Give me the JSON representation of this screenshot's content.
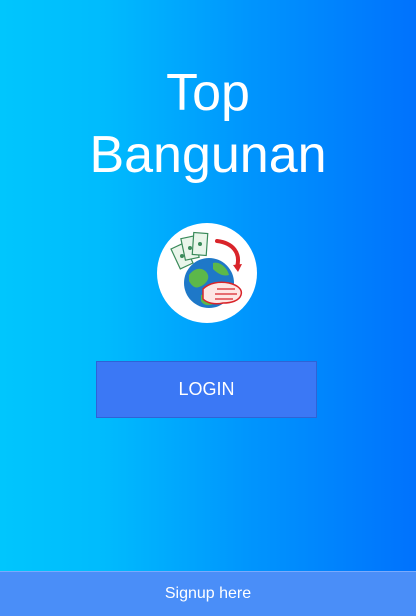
{
  "app": {
    "title_line1": "Top",
    "title_line2": "Bangunan"
  },
  "logo": {
    "icon": "globe-money-hand-logo"
  },
  "login_button": {
    "label": "LOGIN"
  },
  "signup": {
    "label": "Signup here"
  },
  "colors": {
    "gradient_start": "#00c6fd",
    "gradient_end": "#0072fd",
    "button_bg": "#3b78f5",
    "signup_bg": "#4a8ef8"
  }
}
